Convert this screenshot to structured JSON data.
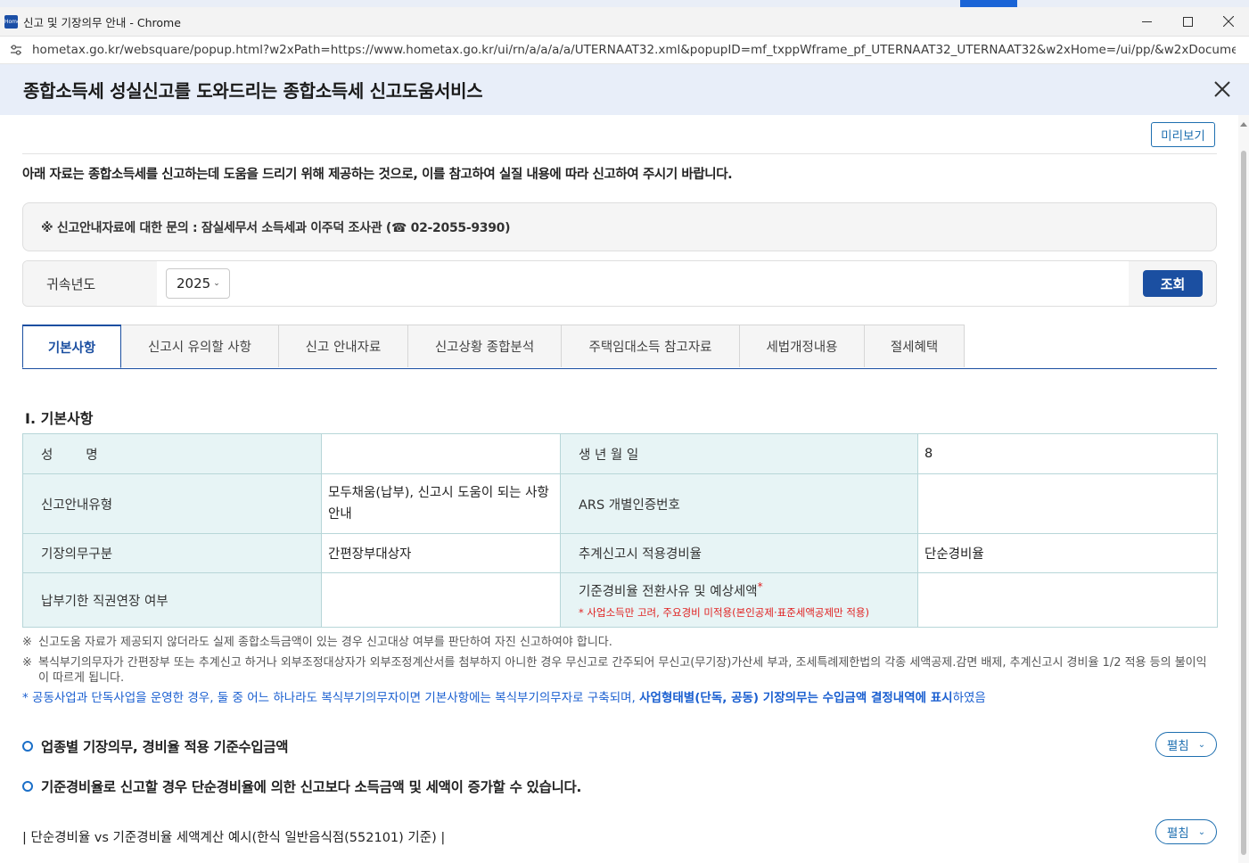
{
  "window": {
    "title": "신고 및 기장의무 안내 - Chrome",
    "favicon_text": "Hometax",
    "url": "hometax.go.kr/websquare/popup.html?w2xPath=https://www.hometax.go.kr/ui/rn/a/a/a/a/UTERNAAT32.xml&popupID=mf_txppWframe_pf_UTERNAAT32_UTERNAAT32&w2xHome=/ui/pp/&w2xDocumentRoot="
  },
  "popup": {
    "title": "종합소득세 성실신고를 도와드리는 종합소득세 신고도움서비스",
    "preview_label": "미리보기",
    "notice": "아래 자료는 종합소득세를 신고하는데 도움을 드리기 위해 제공하는 것으로, 이를 참고하여 실질 내용에 따라 신고하여 주시기 바랍니다.",
    "contact": "※ 신고안내자료에 대한 문의 : 잠실세무서 소득세과 이주덕 조사관 (☎ 02-2055-9390)"
  },
  "search": {
    "year_label": "귀속년도",
    "year_value": "2025",
    "button_label": "조회"
  },
  "tabs": [
    {
      "label": "기본사항"
    },
    {
      "label": "신고시 유의할 사항"
    },
    {
      "label": "신고 안내자료"
    },
    {
      "label": "신고상황 종합분석"
    },
    {
      "label": "주택임대소득 참고자료"
    },
    {
      "label": "세법개정내용"
    },
    {
      "label": "절세혜택"
    }
  ],
  "basic": {
    "section_title": "Ⅰ. 기본사항",
    "name_label": "성        명",
    "name_value": "",
    "birth_label": "생 년 월 일",
    "birth_value": "8",
    "report_type_label": "신고안내유형",
    "report_type_value": "모두채움(납부), 신고시 도움이 되는 사항 안내",
    "ars_label": "ARS 개별인증번호",
    "ars_value": "",
    "bookkeeping_label": "기장의무구분",
    "bookkeeping_value": "간편장부대상자",
    "estimated_rate_label": "추계신고시 적용경비율",
    "estimated_rate_value": "단순경비율",
    "deadline_label": "납부기한 직권연장 여부",
    "deadline_value": "",
    "standard_rate_label": "기준경비율 전환사유 및 예상세액",
    "standard_rate_note": "사업소득만 고려, 주요경비 미적용(본인공제·표준세액공제만 적용)",
    "standard_rate_value": ""
  },
  "notes": [
    "신고도움 자료가 제공되지 않더라도 실제 종합소득금액이 있는 경우 신고대상 여부를 판단하여 자진 신고하여야 합니다.",
    "복식부기의무자가 간편장부 또는 추계신고 하거나 외부조정대상자가 외부조정계산서를 첨부하지 아니한 경우 무신고로 간주되어 무신고(무기장)가산세 부과, 조세특례제한법의 각종 세액공제.감면 배제, 추계신고시 경비율 1/2 적용 등의 불이익이 따르게 됩니다."
  ],
  "blue_note": {
    "prefix": "* 공동사업과 단독사업을 운영한 경우, 둘 중 어느 하나라도 복식부기의무자이면 기본사항에는 복식부기의무자로 구축되며, ",
    "bold": "사업형태별(단독, 공동) 기장의무는 수입금액 결정내역에 표시",
    "suffix": "하였음"
  },
  "items": {
    "industry_title": "업종별 기장의무, 경비율 적용 기준수입금액",
    "standard_warning": "기준경비율로 신고할 경우 단순경비율에 의한 신고보다 소득금액 및 세액이 증가할 수 있습니다.",
    "example_title": "| 단순경비율 vs 기준경비율 세액계산 예시(한식 일반음식점(552101) 기준) |",
    "expand_label": "펼침"
  },
  "colors": {
    "primary": "#1b4fa1",
    "header_bg": "#e8eef9",
    "label_bg": "#e7f4f5",
    "border_teal": "#b7d6d8",
    "warning_red": "#e02020",
    "note_blue": "#1a5fd0"
  },
  "icons": {
    "minimize": "minimize-icon",
    "maximize": "maximize-icon",
    "close": "close-icon",
    "site_settings": "site-settings-icon",
    "popup_close": "close-x-icon",
    "chevron": "chevron-down-icon",
    "circle": "circle-bullet-icon"
  }
}
